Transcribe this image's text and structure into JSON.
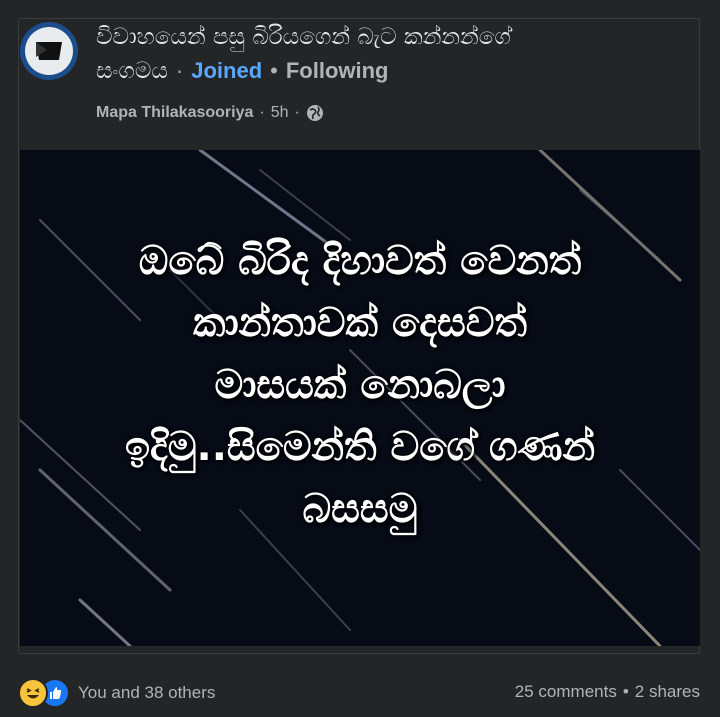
{
  "group": {
    "name_line1": "විවාහයෙන් පසු බිරියගෙන් බැට කන්නන්ගේ",
    "name_line2": "සංගමය",
    "joined_label": "Joined",
    "following_label": "Following",
    "separator": "·",
    "bullet": "•"
  },
  "post": {
    "author": "Mapa Thilakasooriya",
    "time": "5h",
    "privacy_icon": "globe-icon",
    "image_text_lines": [
      "ඔබේ  බිරිද  දිහාවත් වෙනත්",
      "කාන්තාවක්  දෙසවත්",
      "මාසයක් නොබලා",
      "ඉදිමු..සිමෙන්ති වගේ ගණන්",
      "බසසමු"
    ]
  },
  "footer": {
    "reaction_icons": [
      "haha-icon",
      "like-icon"
    ],
    "reactions_text": "You and 38 others",
    "comments_text": "25 comments",
    "shares_text": "2 shares"
  },
  "colors": {
    "background": "#242526",
    "accent": "#5aa7ff",
    "image_bg": "#070b16",
    "like": "#1877f2",
    "haha": "#f7c53d"
  }
}
